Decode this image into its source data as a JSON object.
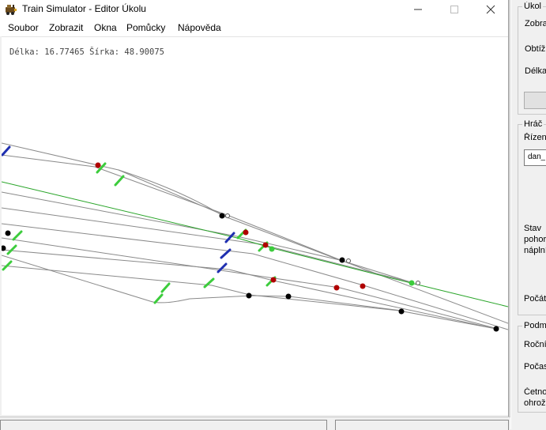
{
  "window": {
    "title": "Train Simulator - Editor Úkolu",
    "minimize_icon": "minimize-icon",
    "maximize_icon": "maximize-icon",
    "close_icon": "close-icon"
  },
  "menu": [
    "Soubor",
    "Zobrazit",
    "Okna",
    "Pomůcky",
    "Nápověda"
  ],
  "map": {
    "coords": "Délka: 16.77465 Šírka: 48.90075"
  },
  "panel": {
    "task_group": {
      "title": "Úkol",
      "rows": [
        "Zobra",
        "Obtížn",
        "Délka"
      ]
    },
    "player_group": {
      "title": "Hráč",
      "controlled_label": "Řízený",
      "controlled_value": "dan_",
      "state_lines": [
        "Stav",
        "pohor",
        "náplní"
      ],
      "count_label": "Počát"
    },
    "conditions_group": {
      "title": "Podm",
      "rows": [
        "Roční",
        "Počasí",
        "Četno",
        "ohrož"
      ]
    }
  },
  "colors": {
    "track": "#8a8a8a",
    "route": "#2aa52a",
    "signal_green": "#3ccc3c",
    "signal_blue": "#1f2fb0",
    "marker_red": "#b00000",
    "marker_black": "#000000"
  }
}
